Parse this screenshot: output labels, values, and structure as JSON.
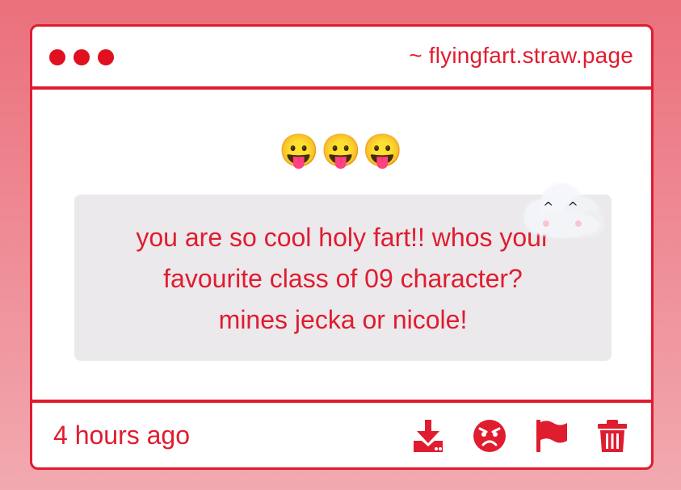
{
  "window": {
    "dots": [
      "dot",
      "dot",
      "dot"
    ],
    "url": "~ flyingfart.straw.page"
  },
  "post": {
    "emojis": "😛😛😛",
    "message_lines": [
      "you are so cool holy fart!! whos your",
      "favourite class of 09 character?",
      "mines jecka or nicole!"
    ],
    "sticker": "cloud-sticker",
    "sticker_face": "^ ^"
  },
  "footer": {
    "timestamp": "4 hours ago",
    "actions": [
      "download-icon",
      "angry-face-icon",
      "flag-icon",
      "trash-icon"
    ]
  },
  "colors": {
    "accent": "#e01c2f",
    "message_bg": "#ebe9ec",
    "page_bg_top": "#ea707c",
    "page_bg_bottom": "#f2a9b0"
  }
}
